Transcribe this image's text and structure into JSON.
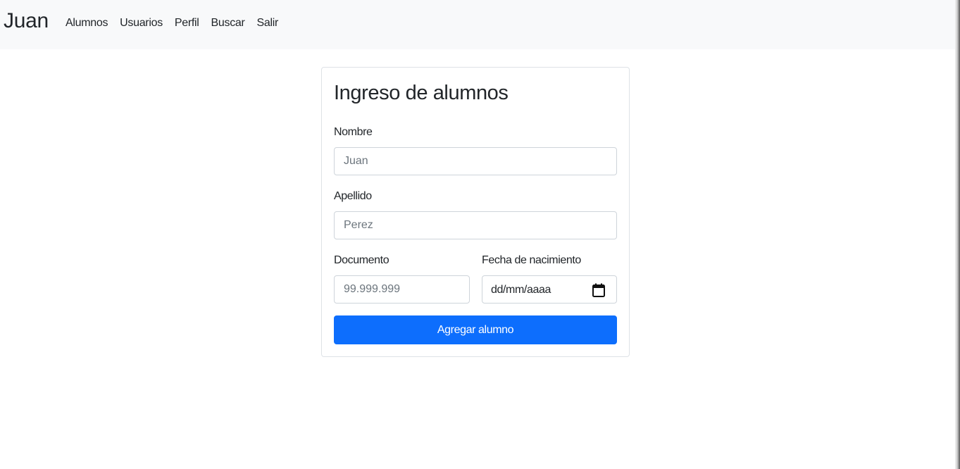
{
  "navbar": {
    "brand": "Juan",
    "links": [
      {
        "label": "Alumnos"
      },
      {
        "label": "Usuarios"
      },
      {
        "label": "Perfil"
      },
      {
        "label": "Buscar"
      },
      {
        "label": "Salir"
      }
    ]
  },
  "form": {
    "title": "Ingreso de alumnos",
    "nombre": {
      "label": "Nombre",
      "value": "",
      "placeholder": "Juan"
    },
    "apellido": {
      "label": "Apellido",
      "value": "",
      "placeholder": "Perez"
    },
    "documento": {
      "label": "Documento",
      "value": "",
      "placeholder": "99.999.999"
    },
    "fecha": {
      "label": "Fecha de nacimiento",
      "display": "dd/mm/aaaa",
      "icon": "calendar-icon"
    },
    "submit_label": "Agregar alumno"
  },
  "colors": {
    "primary": "#0d6efd",
    "navbar_bg": "#f8f9fa",
    "border": "#ced4da"
  }
}
